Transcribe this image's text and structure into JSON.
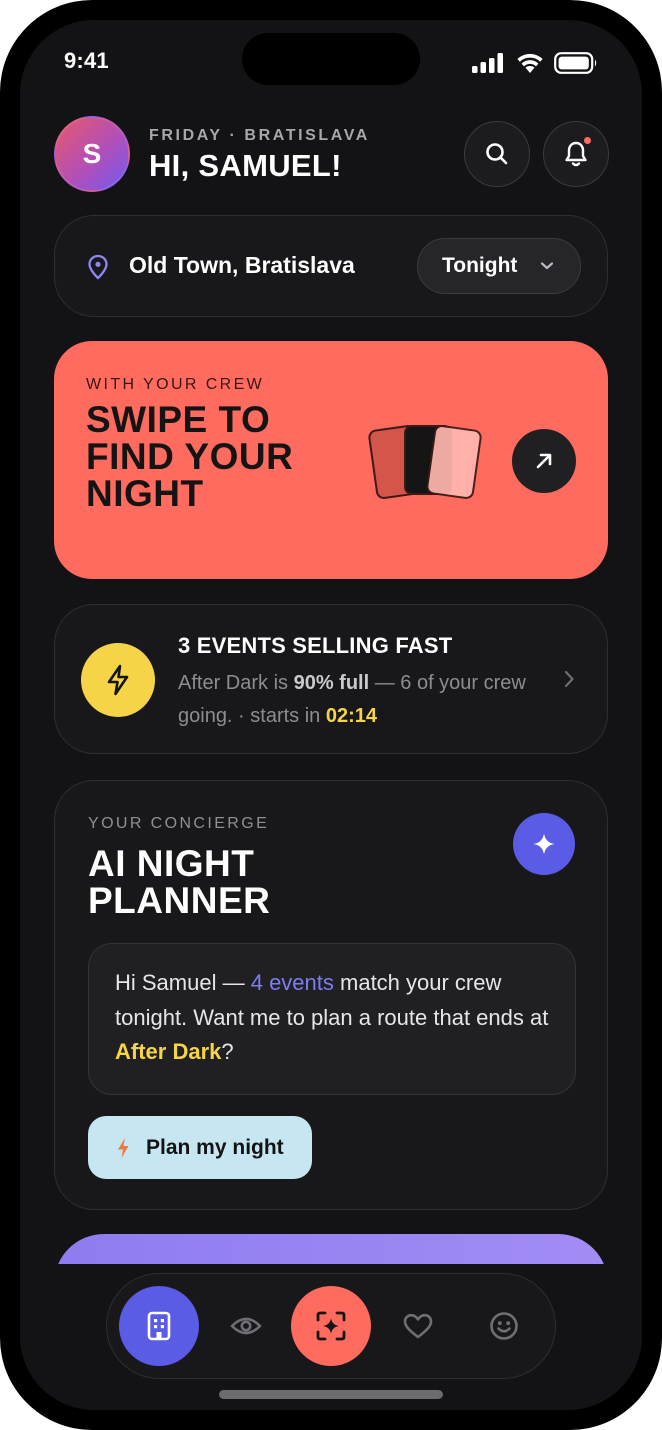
{
  "status_bar": {
    "time": "9:41"
  },
  "header": {
    "avatar_initial": "S",
    "subtitle": "FRIDAY · BRATISLAVA",
    "title": "HI, SAMUEL!"
  },
  "location": {
    "name": "Old Town, Bratislava",
    "time_filter": "Tonight"
  },
  "swipe_card": {
    "eyebrow": "WITH YOUR CREW",
    "title": "SWIPE TO FIND YOUR NIGHT"
  },
  "selling_fast": {
    "title": "3 EVENTS SELLING FAST",
    "desc_prefix": "After Dark is ",
    "desc_bold": "90% full",
    "desc_middle": " — 6 of your crew going. · starts in ",
    "desc_timer": "02:14"
  },
  "planner": {
    "eyebrow": "YOUR CONCIERGE",
    "title": "AI NIGHT PLANNER",
    "message_prefix": "Hi Samuel — ",
    "message_link": "4 events",
    "message_middle": " match your crew tonight. Want me to plan a route that ends at ",
    "message_venue": "After Dark",
    "message_suffix": "?",
    "button_label": "Plan my night"
  },
  "tabbar": {
    "items": [
      {
        "icon": "building-icon",
        "active": true
      },
      {
        "icon": "eye-icon"
      },
      {
        "icon": "scan-sparkle-icon",
        "accent": true
      },
      {
        "icon": "heart-icon"
      },
      {
        "icon": "smile-icon"
      }
    ]
  },
  "colors": {
    "background": "#131315",
    "card": "#18181b",
    "coral": "#ff6b5e",
    "indigo": "#5a5ce6",
    "yellow": "#f5d547",
    "light_blue": "#c6e6f2",
    "lavender": "#a38cf4"
  }
}
